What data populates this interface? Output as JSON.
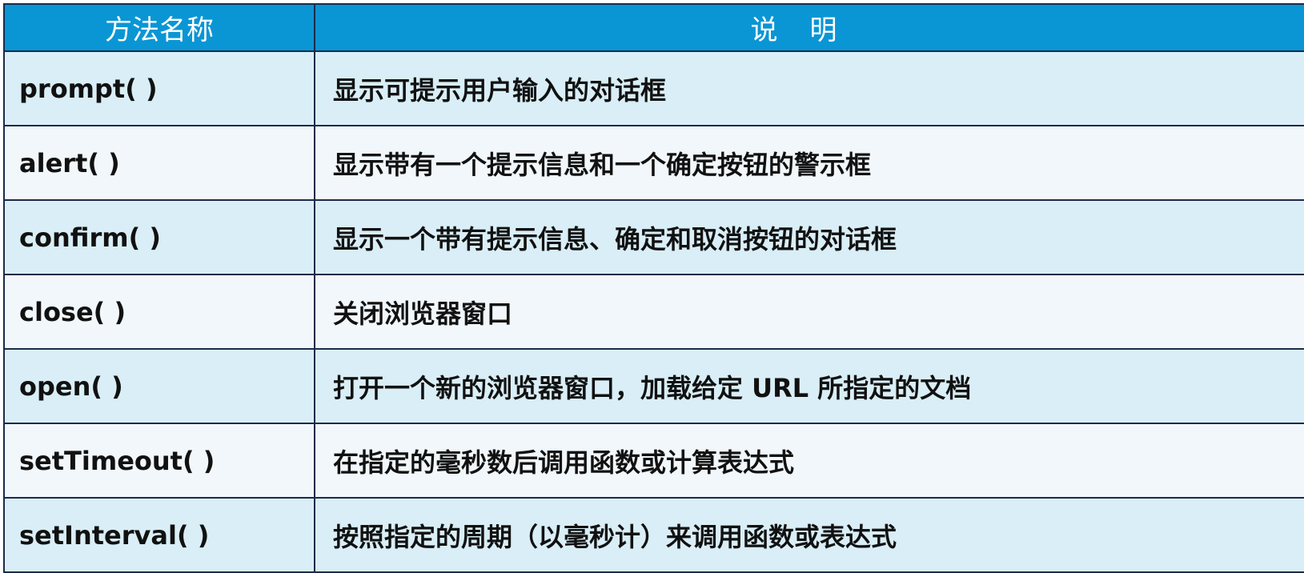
{
  "table": {
    "headers": {
      "name": "方法名称",
      "desc": "说明"
    },
    "rows": [
      {
        "name": "prompt( )",
        "desc": "显示可提示用户输入的对话框"
      },
      {
        "name": "alert( )",
        "desc": "显示带有一个提示信息和一个确定按钮的警示框"
      },
      {
        "name": "confirm( )",
        "desc": "显示一个带有提示信息、确定和取消按钮的对话框"
      },
      {
        "name": "close( )",
        "desc": "关闭浏览器窗口"
      },
      {
        "name": "open( )",
        "desc": "打开一个新的浏览器窗口，加载给定 URL 所指定的文档"
      },
      {
        "name": "setTimeout( )",
        "desc": "在指定的毫秒数后调用函数或计算表达式"
      },
      {
        "name": "setInterval( )",
        "desc": "按照指定的周期（以毫秒计）来调用函数或表达式"
      }
    ]
  },
  "colors": {
    "header_bg": "#0a96d4",
    "row_odd_bg": "#d9eef6",
    "row_even_bg": "#f1f7fb",
    "border": "#1c2a4a"
  }
}
